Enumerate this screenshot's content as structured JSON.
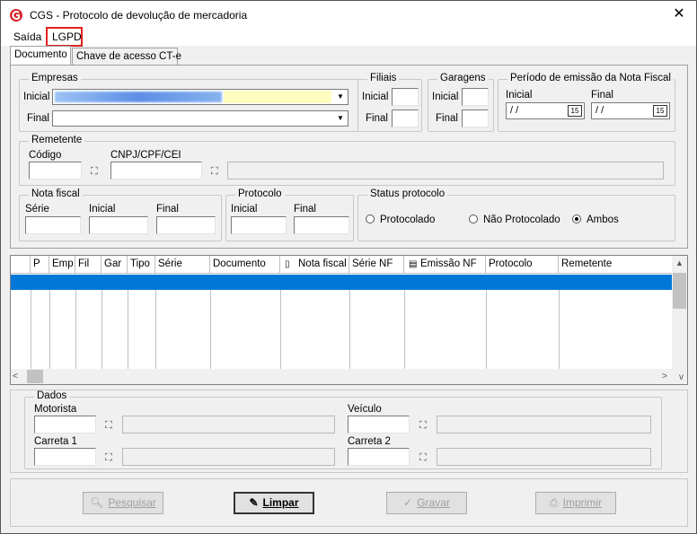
{
  "window": {
    "title": "CGS - Protocolo de devolução de mercadoria"
  },
  "menu": {
    "items": [
      {
        "label": "Saída"
      },
      {
        "label": "LGPD"
      }
    ]
  },
  "tabs": [
    {
      "label": "Documento"
    },
    {
      "label": "Chave de acesso CT-e"
    }
  ],
  "empresas": {
    "title": "Empresas",
    "inicial_label": "Inicial",
    "final_label": "Final"
  },
  "filiais": {
    "title": "Filiais",
    "inicial_label": "Inicial",
    "final_label": "Final"
  },
  "garagens": {
    "title": "Garagens",
    "inicial_label": "Inicial",
    "final_label": "Final"
  },
  "periodo": {
    "title": "Período de emissão da Nota Fiscal",
    "inicial_label": "Inicial",
    "final_label": "Final",
    "inicial_value": " / /",
    "final_value": " / /",
    "cal_icon": "15"
  },
  "remetente": {
    "title": "Remetente",
    "codigo_label": "Código",
    "cnpj_label": "CNPJ/CPF/CEI"
  },
  "nota_fiscal": {
    "title": "Nota fiscal",
    "serie_label": "Série",
    "inicial_label": "Inicial",
    "final_label": "Final"
  },
  "protocolo": {
    "title": "Protocolo",
    "inicial_label": "Inicial",
    "final_label": "Final"
  },
  "status": {
    "title": "Status protocolo",
    "options": [
      {
        "label": "Protocolado",
        "checked": false
      },
      {
        "label": "Não Protocolado",
        "checked": false
      },
      {
        "label": "Ambos",
        "checked": true
      }
    ]
  },
  "grid": {
    "columns": [
      "",
      "P",
      "Emp",
      "Fil",
      "Gar",
      "Tipo",
      "Série",
      "Documento",
      "Nota fiscal",
      "Série NF",
      "Emissão NF",
      "Protocolo",
      "Remetente"
    ]
  },
  "dados": {
    "title": "Dados",
    "motorista_label": "Motorista",
    "veiculo_label": "Veículo",
    "carreta1_label": "Carreta 1",
    "carreta2_label": "Carreta 2"
  },
  "buttons": {
    "pesquisar": "Pesquisar",
    "limpar": "Limpar",
    "gravar": "Gravar",
    "imprimir": "Imprimir"
  },
  "icons": {
    "binoculars": "binoculars-icon",
    "close": "close-icon"
  },
  "colors": {
    "selection": "#0078d7",
    "highlight_box": "#e02020"
  }
}
